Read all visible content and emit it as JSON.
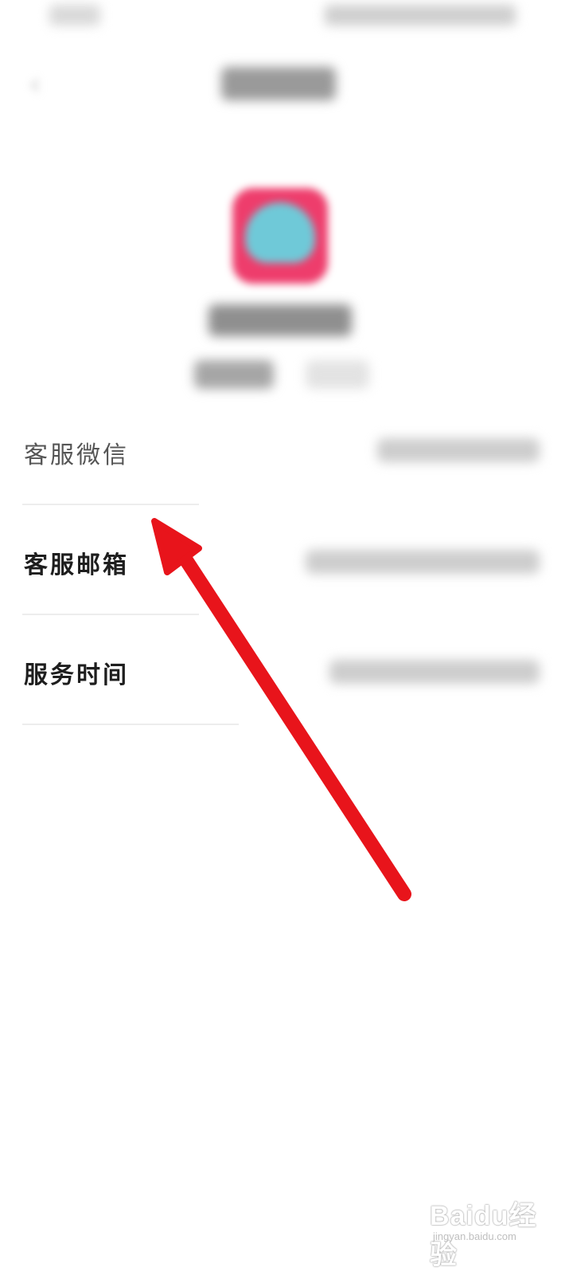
{
  "info_rows": [
    {
      "label": "客服微信"
    },
    {
      "label": "客服邮箱"
    },
    {
      "label": "服务时间"
    }
  ],
  "watermark": {
    "main": "Baidu经验",
    "sub": "jingyan.baidu.com"
  },
  "colors": {
    "annotation_arrow": "#e8141b",
    "app_logo": "#ee3d6c"
  }
}
